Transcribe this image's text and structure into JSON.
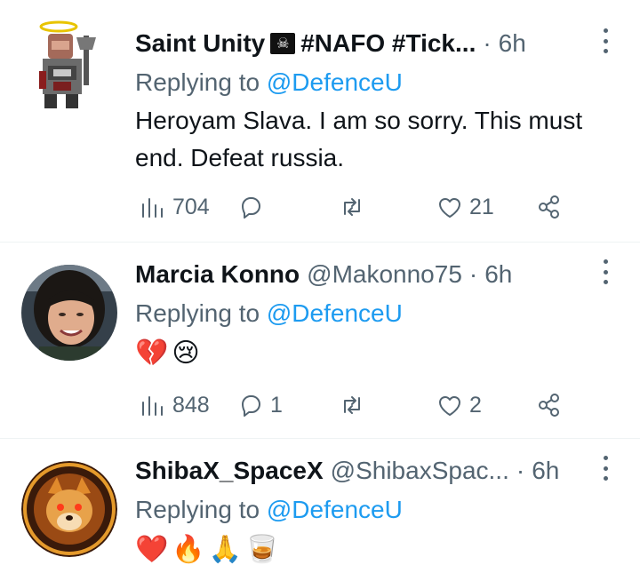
{
  "tweets": [
    {
      "display_name": "Saint Unity",
      "name_emoji": "☠",
      "name_suffix": "#NAFO #Tick...",
      "handle": "",
      "dot": "·",
      "time": "6h",
      "replying_prefix": "Replying to",
      "replying_to": "@DefenceU",
      "text": "Heroyam Slava. I am so sorry. This must end. Defeat russia.",
      "views": "704",
      "replies": "",
      "retweets": "",
      "likes": "21"
    },
    {
      "display_name": "Marcia Konno",
      "handle": "@Makonno75",
      "dot": "·",
      "time": "6h",
      "replying_prefix": "Replying to",
      "replying_to": "@DefenceU",
      "emojis": [
        "💔",
        "😢"
      ],
      "views": "848",
      "replies": "1",
      "retweets": "",
      "likes": "2"
    },
    {
      "display_name": "ShibaX_SpaceX",
      "handle": "@ShibaxSpac...",
      "dot": "·",
      "time": "6h",
      "replying_prefix": "Replying to",
      "replying_to": "@DefenceU",
      "emojis": [
        "❤️",
        "🔥",
        "🙏",
        "🥃"
      ]
    }
  ],
  "colors": {
    "link": "#1d9bf0",
    "secondary_text": "#536471",
    "primary_text": "#0f1419",
    "divider": "#eff3f4"
  }
}
